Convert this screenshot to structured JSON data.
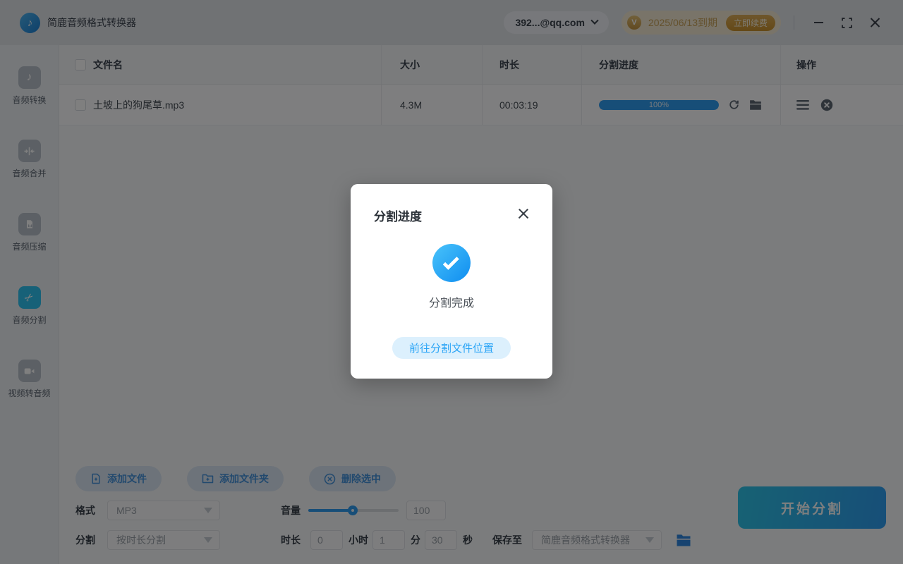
{
  "titlebar": {
    "app_title": "简鹿音频格式转换器",
    "account": "392...@qq.com",
    "vip_expiry": "2025/06/13到期",
    "renew_label": "立即续费"
  },
  "sidebar": {
    "items": [
      {
        "label": "音频转换",
        "active": false
      },
      {
        "label": "音频合并",
        "active": false
      },
      {
        "label": "音频压缩",
        "active": false
      },
      {
        "label": "音频分割",
        "active": true
      },
      {
        "label": "视频转音频",
        "active": false
      }
    ]
  },
  "table": {
    "headers": [
      "文件名",
      "大小",
      "时长",
      "分割进度",
      "操作"
    ],
    "rows": [
      {
        "name": "土坡上的狗尾草.mp3",
        "size": "4.3M",
        "duration": "00:03:19",
        "progress_label": "100%",
        "progress_percent": 100
      }
    ]
  },
  "toolbar": {
    "add_file": "添加文件",
    "add_folder": "添加文件夹",
    "delete_selected": "删除选中"
  },
  "settings": {
    "format_label": "格式",
    "format_value": "MP3",
    "volume_label": "音量",
    "volume_value": "100",
    "volume_percent": 49,
    "split_label": "分割",
    "split_mode": "按时长分割",
    "duration_label": "时长",
    "hours_value": "0",
    "hours_unit": "小时",
    "minutes_value": "1",
    "minutes_unit": "分",
    "seconds_value": "30",
    "seconds_unit": "秒",
    "save_label": "保存至",
    "save_location": "简鹿音频格式转换器"
  },
  "start_button_label": "开始分割",
  "modal": {
    "title": "分割进度",
    "status": "分割完成",
    "action_label": "前往分割文件位置"
  },
  "colors": {
    "accent_blue": "#2e9cf0",
    "active_sidebar_icon": "#2fc3f0",
    "vip_gold": "#d2a04e",
    "progress_fill": "#2e9cf0",
    "start_gradient_left": "#2ec4e8",
    "start_gradient_right": "#2f9df0",
    "modal_check": "#1a9af2",
    "overlay": "rgba(0,0,0,0.5)"
  },
  "icons": {
    "logo": "music-note",
    "account_chevron": "chevron-down",
    "vip_medal": "V-medal",
    "window": [
      "minimize",
      "fullscreen",
      "close"
    ],
    "sidebar": [
      "music-note",
      "merge-arrows",
      "compress-file",
      "scissors",
      "video-camera"
    ],
    "row_actions": [
      "refresh",
      "open-folder",
      "menu-lines",
      "remove-circle-x"
    ],
    "toolbar": [
      "file-plus",
      "folder-plus",
      "circle-x"
    ],
    "save_folder": "folder",
    "modal": [
      "close-x",
      "check-circle"
    ]
  }
}
